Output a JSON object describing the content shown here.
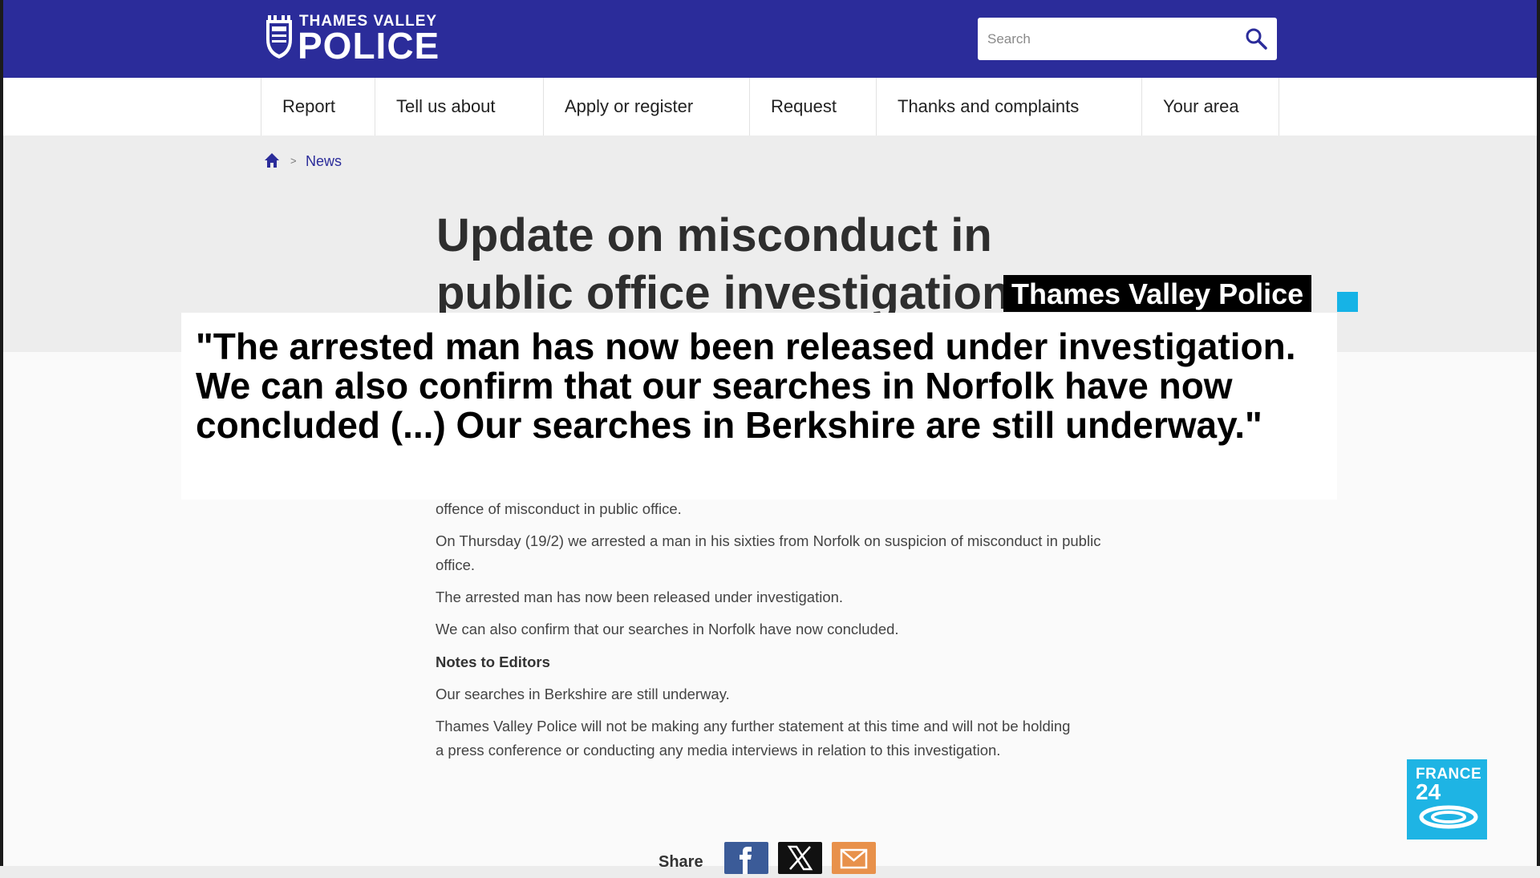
{
  "header": {
    "logo_line1": "THAMES VALLEY",
    "logo_line2": "POLICE",
    "search_placeholder": "Search"
  },
  "nav": {
    "items": [
      "Report",
      "Tell us about",
      "Apply or register",
      "Request",
      "Thanks and complaints",
      "Your area"
    ]
  },
  "breadcrumb": {
    "current": "News"
  },
  "article": {
    "title": "Update on misconduct in public office investigation",
    "paragraphs": [
      "offence of misconduct in public office.",
      "On Thursday (19/2) we arrested a man in his sixties from Norfolk on suspicion of misconduct in public office.",
      "The arrested man has now been released under investigation.",
      "We can also confirm that our searches in Norfolk have now concluded.",
      "Notes to Editors",
      "Our searches in Berkshire are still underway.",
      "Thames Valley Police will not be making any further statement at this time and will not be holding a press conference or conducting any media interviews in relation to this investigation."
    ],
    "share_label": "Share"
  },
  "overlay": {
    "source_tag": "Thames Valley Police",
    "quote": "\"The arrested man has now been released under investigation. We can also confirm that our searches in Norfolk have now concluded (...) Our searches in Berkshire are still underway.\""
  },
  "broadcaster": {
    "line1": "FRANCE",
    "line2": "24"
  },
  "colors": {
    "header_blue": "#2b2c9a",
    "accent_cyan": "#16b3e6",
    "facebook": "#3b5b98",
    "email": "#e8914b"
  },
  "icons": [
    "crest-logo-icon",
    "search-icon",
    "home-icon",
    "facebook-icon",
    "x-icon",
    "email-icon"
  ]
}
